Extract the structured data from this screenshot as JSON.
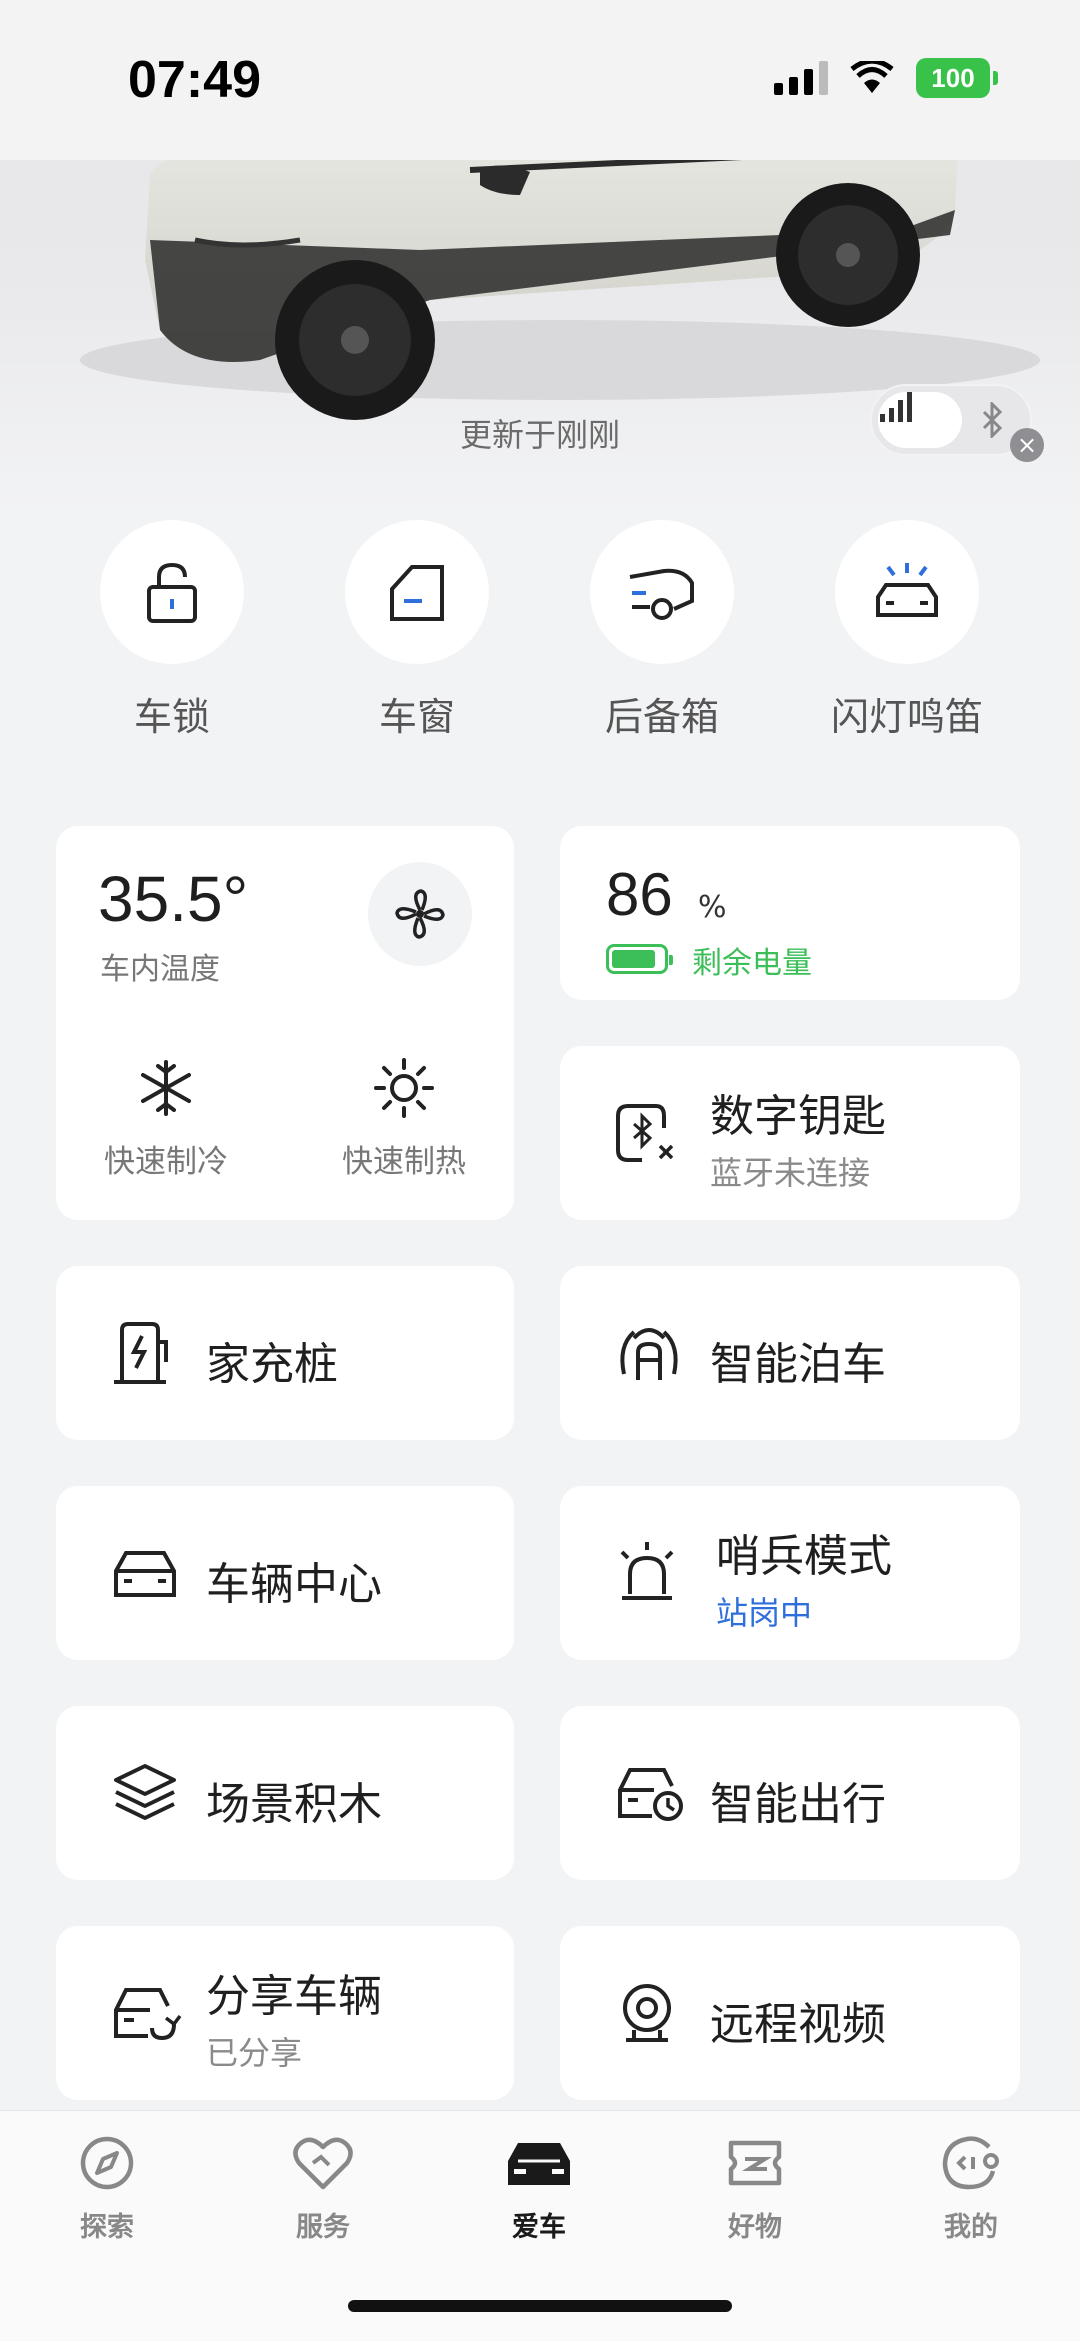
{
  "status_bar": {
    "time": "07:49",
    "battery": "100"
  },
  "hero": {
    "updated_text": "更新于刚刚"
  },
  "quick_controls": [
    {
      "label": "车锁",
      "icon": "lock-icon"
    },
    {
      "label": "车窗",
      "icon": "window-icon"
    },
    {
      "label": "后备箱",
      "icon": "trunk-icon"
    },
    {
      "label": "闪灯鸣笛",
      "icon": "flash-horn-icon"
    }
  ],
  "climate": {
    "temperature": "35.5°",
    "temperature_label": "车内温度",
    "cool_label": "快速制冷",
    "heat_label": "快速制热"
  },
  "battery_card": {
    "value": "86",
    "unit": "%",
    "label": "剩余电量",
    "level": 0.86
  },
  "digital_key": {
    "title": "数字钥匙",
    "status": "蓝牙未连接"
  },
  "home_charger": {
    "title": "家充桩"
  },
  "smart_parking": {
    "title": "智能泊车"
  },
  "vehicle_center": {
    "title": "车辆中心"
  },
  "sentry_mode": {
    "title": "哨兵模式",
    "status": "站岗中"
  },
  "scene_blocks": {
    "title": "场景积木"
  },
  "smart_travel": {
    "title": "智能出行"
  },
  "share_vehicle": {
    "title": "分享车辆",
    "status": "已分享"
  },
  "remote_video": {
    "title": "远程视频"
  },
  "bottom_nav": [
    {
      "label": "探索",
      "icon": "explore-icon"
    },
    {
      "label": "服务",
      "icon": "service-icon"
    },
    {
      "label": "爱车",
      "icon": "car-icon"
    },
    {
      "label": "好物",
      "icon": "shop-icon"
    },
    {
      "label": "我的",
      "icon": "profile-icon"
    }
  ],
  "colors": {
    "accent": "#2f6fdc",
    "battery_green": "#3cbf58",
    "status_battery": "#39c24a"
  }
}
